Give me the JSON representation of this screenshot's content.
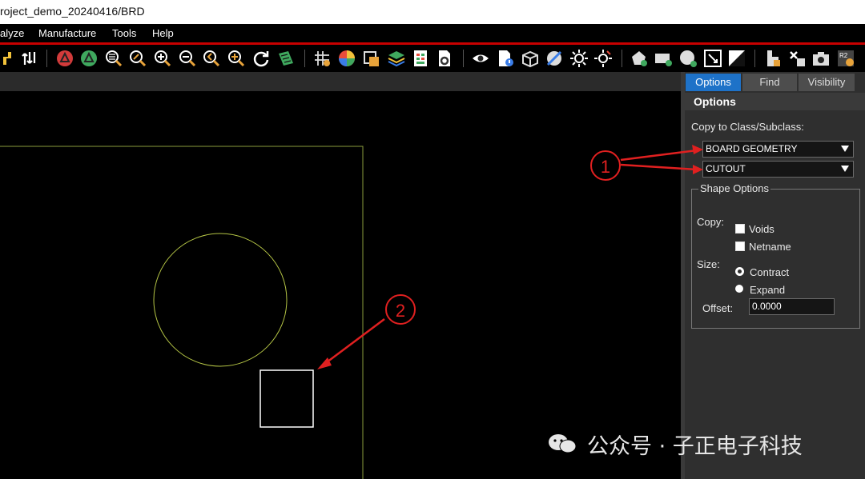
{
  "window": {
    "title": "roject_demo_20240416/BRD"
  },
  "menu": {
    "items": [
      "alyze",
      "Manufacture",
      "Tools",
      "Help"
    ]
  },
  "toolbar": {
    "icons": [
      "route-icon",
      "swap-icon",
      "drc-red-icon",
      "drc-green-icon",
      "zoom-fit-icon",
      "zoom-select-icon",
      "zoom-in-icon",
      "zoom-out-icon",
      "zoom-prev-icon",
      "zoom-world-icon",
      "redraw-icon",
      "layer-3d-icon",
      "grid-icon",
      "color-icon",
      "shadow-icon",
      "layers-icon",
      "report-icon",
      "config-icon",
      "visibility-eye-icon",
      "properties-icon",
      "3d-view-icon",
      "ratsnest-icon",
      "highlight-icon",
      "dehighlight-icon",
      "shape-add-icon",
      "rect-add-icon",
      "circle-add-icon",
      "select-shape-icon",
      "void-icon",
      "place-icon",
      "unplace-icon",
      "snapshot-icon",
      "rules-icon"
    ]
  },
  "panel": {
    "tabs": [
      "Options",
      "Find",
      "Visibility"
    ],
    "header": "Options",
    "copy_to_label": "Copy to Class/Subclass:",
    "class_value": "BOARD GEOMETRY",
    "subclass_value": "CUTOUT",
    "shape_options": {
      "legend": "Shape Options",
      "copy_label": "Copy:",
      "voids_label": "Voids",
      "netname_label": "Netname",
      "size_label": "Size:",
      "contract_label": "Contract",
      "expand_label": "Expand",
      "size_selected": "Contract",
      "offset_label": "Offset:",
      "offset_value": "0.0000"
    }
  },
  "annotations": {
    "marker1": "1",
    "marker2": "2"
  },
  "watermark": "公众号 · 子正电子科技",
  "colors": {
    "board_outline": "#8a9b3c",
    "circle_shape": "#b4c445",
    "selected_rect": "#ffffff",
    "annotation_red": "#e02020",
    "tab_active": "#1e72c8"
  }
}
